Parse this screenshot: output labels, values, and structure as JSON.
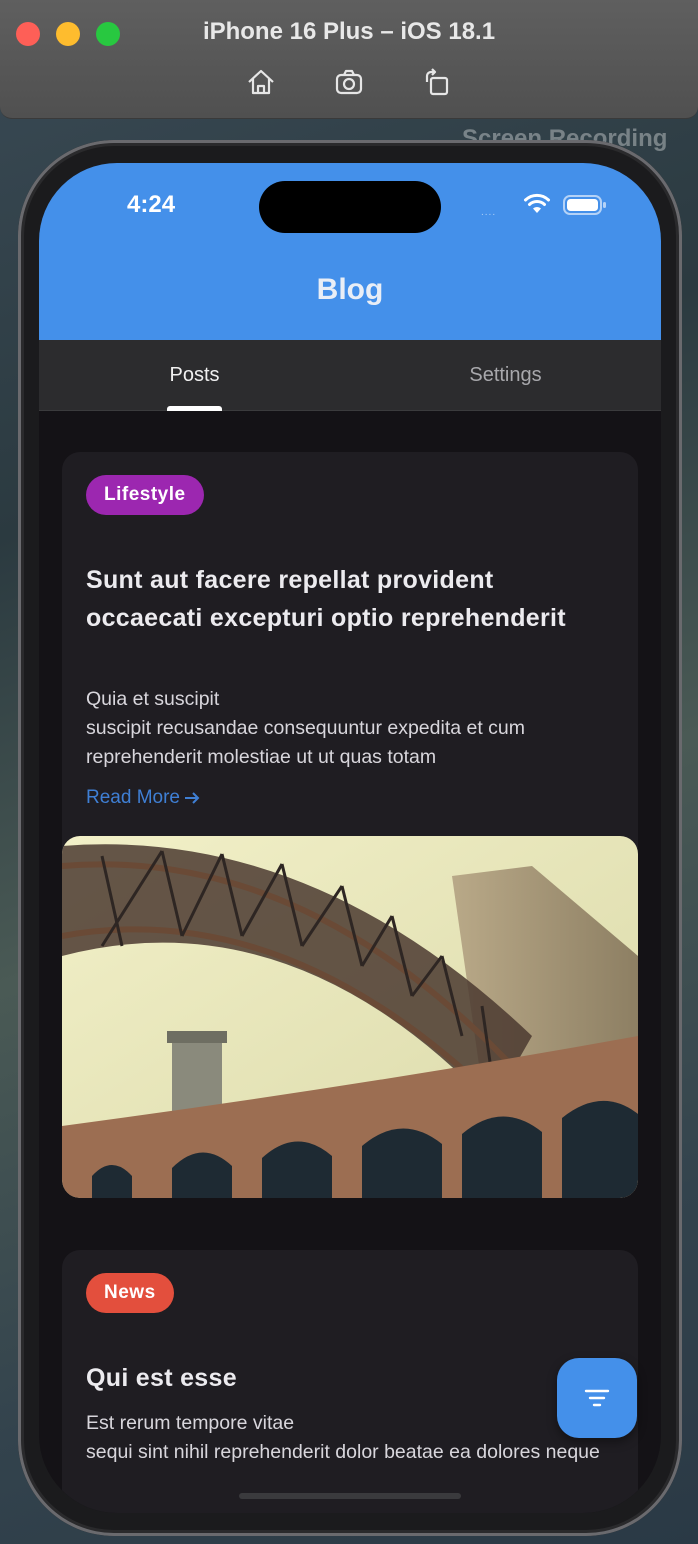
{
  "simulator": {
    "title": "iPhone 16 Plus – iOS 18.1",
    "tools": [
      "home-icon",
      "screenshot-icon",
      "rotate-icon"
    ],
    "overlay_text": "Screen Recording\nov"
  },
  "status_bar": {
    "time": "4:24",
    "signal": "....",
    "icons": [
      "wifi-icon",
      "battery-icon"
    ]
  },
  "app_bar": {
    "title": "Blog",
    "color": "#4490ea"
  },
  "tabs": [
    {
      "label": "Posts",
      "selected": true
    },
    {
      "label": "Settings",
      "selected": false
    }
  ],
  "posts": [
    {
      "category": "Lifestyle",
      "category_color": "#9c27b0",
      "title": "Sunt aut facere repellat provident occaecati excepturi optio reprehenderit",
      "body": "Quia et suscipit\nsuscipit recusandae consequuntur expedita et cum reprehenderit molestiae ut ut quas totam",
      "read_more": "Read More",
      "image": "bridge-photo"
    },
    {
      "category": "News",
      "category_color": "#e34f3d",
      "title": "Qui est esse",
      "body": "Est rerum tempore vitae\nsequi sint nihil reprehenderit dolor beatae ea dolores neque"
    }
  ],
  "fab": {
    "icon": "filter-icon"
  }
}
